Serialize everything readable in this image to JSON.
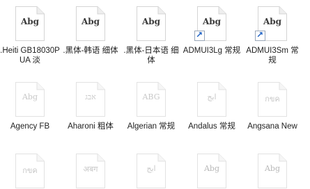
{
  "items": [
    {
      "label": ".Heiti GB18030PUA 淡",
      "sample": "Abg",
      "style": "dark",
      "shortcut": false
    },
    {
      "label": ".黑体-韩语 细体",
      "sample": "Abg",
      "style": "dark",
      "shortcut": false
    },
    {
      "label": ".黑体-日本语 细体",
      "sample": "Abg",
      "style": "dark",
      "shortcut": false
    },
    {
      "label": "ADMUI3Lg 常规",
      "sample": "Abg",
      "style": "dark",
      "shortcut": true
    },
    {
      "label": "ADMUI3Sm 常规",
      "sample": "Abg",
      "style": "dark",
      "shortcut": true
    },
    {
      "label": "Agency FB",
      "sample": "Abg",
      "style": "faded",
      "shortcut": false
    },
    {
      "label": "Aharoni 粗体",
      "sample": "אבג",
      "style": "faded",
      "shortcut": false
    },
    {
      "label": "Algerian 常规",
      "sample": "ABG",
      "style": "faded",
      "shortcut": false
    },
    {
      "label": "Andalus 常规",
      "sample": "ابج",
      "style": "faded",
      "shortcut": false
    },
    {
      "label": "Angsana New",
      "sample": "กขค",
      "style": "faded",
      "shortcut": false
    },
    {
      "label": "",
      "sample": "กขค",
      "style": "faded",
      "shortcut": false
    },
    {
      "label": "",
      "sample": "अबग",
      "style": "faded",
      "shortcut": false
    },
    {
      "label": "",
      "sample": "ابج",
      "style": "faded",
      "shortcut": false
    },
    {
      "label": "",
      "sample": "Abg",
      "style": "faded-gray",
      "shortcut": false
    },
    {
      "label": "",
      "sample": "Abg",
      "style": "faded-gray",
      "shortcut": false
    }
  ],
  "colors": {
    "dark_text": "#3a3a3a",
    "faded_text": "#c8c8c8",
    "page_border": "#d4d4d4",
    "shortcut_arrow": "#1a5fc4"
  }
}
